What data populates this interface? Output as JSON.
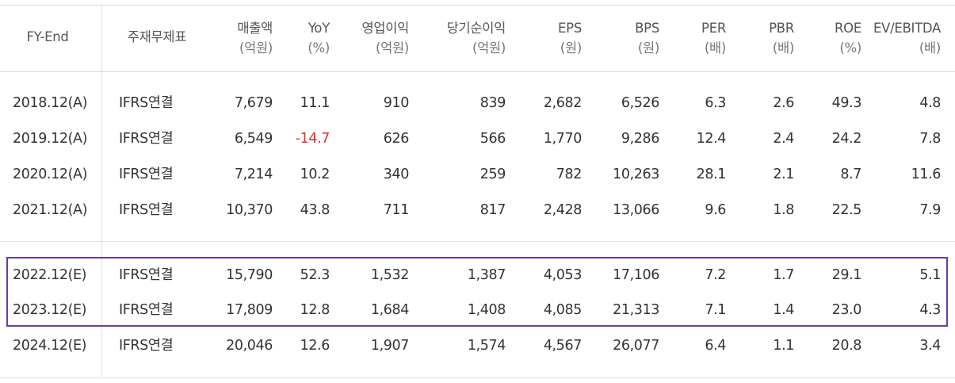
{
  "headers": [
    {
      "line1": "FY-End",
      "line2": ""
    },
    {
      "line1": "주재무제표",
      "line2": ""
    },
    {
      "line1": "매출액",
      "line2": "(억원)"
    },
    {
      "line1": "YoY",
      "line2": "(%)"
    },
    {
      "line1": "영업이익",
      "line2": "(억원)"
    },
    {
      "line1": "당기순이익",
      "line2": "(억원)"
    },
    {
      "line1": "EPS",
      "line2": "(원)"
    },
    {
      "line1": "BPS",
      "line2": "(원)"
    },
    {
      "line1": "PER",
      "line2": "(배)"
    },
    {
      "line1": "PBR",
      "line2": "(배)"
    },
    {
      "line1": "ROE",
      "line2": "(%)"
    },
    {
      "line1": "EV/EBITDA",
      "line2": "(배)"
    }
  ],
  "rows": [
    [
      "2018.12(A)",
      "IFRS연결",
      "7,679",
      "11.1",
      "910",
      "839",
      "2,682",
      "6,526",
      "6.3",
      "2.6",
      "49.3",
      "4.8"
    ],
    [
      "2019.12(A)",
      "IFRS연결",
      "6,549",
      "-14.7",
      "626",
      "566",
      "1,770",
      "9,286",
      "12.4",
      "2.4",
      "24.2",
      "7.8"
    ],
    [
      "2020.12(A)",
      "IFRS연결",
      "7,214",
      "10.2",
      "340",
      "259",
      "782",
      "10,263",
      "28.1",
      "2.1",
      "8.7",
      "11.6"
    ],
    [
      "2021.12(A)",
      "IFRS연결",
      "10,370",
      "43.8",
      "711",
      "817",
      "2,428",
      "13,066",
      "9.6",
      "1.8",
      "22.5",
      "7.9"
    ],
    [
      "2022.12(E)",
      "IFRS연결",
      "15,790",
      "52.3",
      "1,532",
      "1,387",
      "4,053",
      "17,106",
      "7.2",
      "1.7",
      "29.1",
      "5.1"
    ],
    [
      "2023.12(E)",
      "IFRS연결",
      "17,809",
      "12.8",
      "1,684",
      "1,408",
      "4,085",
      "21,313",
      "7.1",
      "1.4",
      "23.0",
      "4.3"
    ],
    [
      "2024.12(E)",
      "IFRS연결",
      "20,046",
      "12.6",
      "1,907",
      "1,574",
      "4,567",
      "26,077",
      "6.4",
      "1.1",
      "20.8",
      "3.4"
    ]
  ],
  "colors": {
    "negative": "#e0312f",
    "highlight_border": "#6a3d9a",
    "text": "#333333"
  }
}
